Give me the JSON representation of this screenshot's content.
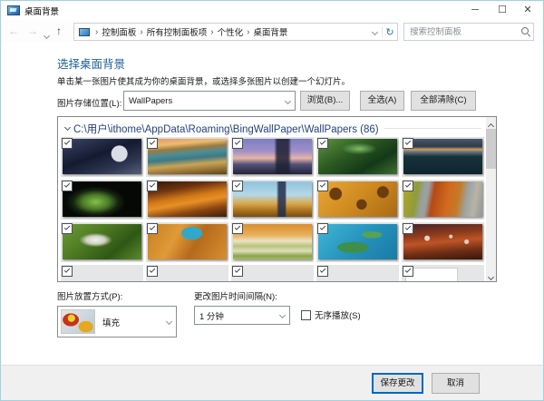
{
  "window": {
    "title": "桌面背景",
    "controls": {
      "minimize": "─",
      "maximize": "☐",
      "close": "✕"
    }
  },
  "colors": {
    "accent": "#0067c0",
    "heading": "#1d6097",
    "group": "#26427c",
    "win-border": "#9fd3e2"
  },
  "navbar": {
    "back_icon": "←",
    "forward_icon": "→",
    "up_icon": "↑",
    "refresh_icon": "↻",
    "address": {
      "crumbs": [
        "控制面板",
        "所有控制面板项",
        "个性化",
        "桌面背景"
      ],
      "separator": "›"
    },
    "search": {
      "placeholder": "搜索控制面板"
    }
  },
  "main": {
    "heading": "选择桌面背景",
    "description": "单击某一张图片使其成为你的桌面背景，或选择多张图片以创建一个幻灯片。",
    "location_row": {
      "label": "图片存储位置(L):",
      "dropdown_value": "WallPapers",
      "browse_button": "浏览(B)...",
      "select_all_button": "全选(A)",
      "clear_all_button": "全部清除(C)"
    },
    "gallery": {
      "group_header": "C:\\用户\\ithome\\AppData\\Roaming\\BingWallPaper\\WallPapers (86)",
      "thumbnails": [
        {
          "name": "night-observatory",
          "checked": true,
          "image": "radial-gradient(circle at 72% 42%, #d8dde6 0, #d8dde6 13%, rgba(216,221,230,0) 14%), linear-gradient(160deg, #3a4668 0%, #141a30 45%, #2e3752 75%, #585f78 100%)"
        },
        {
          "name": "sunset-mountain-lake",
          "checked": true,
          "image": "linear-gradient(175deg, #e0956a 0%, #edbb72 18%, #9a7a3e 30%, #4e8d96 42%, #3c7a85 55%, #caa355 70%, #8a6a30 88%, #5a4418 100%)"
        },
        {
          "name": "twilight-city-trees",
          "checked": true,
          "image": "linear-gradient(90deg, rgba(30,30,50,0) 52%, rgba(30,32,52,0.85) 56%, rgba(30,32,52,0.85) 70%, rgba(30,30,50,0) 74%), linear-gradient(180deg, #7d7fc0 0%, #a18fc9 35%, #e8b4a4 55%, #53537a 72%, #23233a 100%)"
        },
        {
          "name": "green-forest-stream",
          "checked": true,
          "image": "radial-gradient(ellipse 30% 22% at 52% 28%, #7fbf68 0%, rgba(127,191,104,0) 75%), linear-gradient(150deg, #5d9440 0%, #2c5a22 40%, #143818 70%, #3f7032 100%)"
        },
        {
          "name": "dark-sea-dusk",
          "checked": true,
          "image": "linear-gradient(180deg, #49596b 0%, #2e3b4c 22%, #d99a55 30%, #6b7a80 36%, #17323c 50%, #0d252e 100%)"
        },
        {
          "name": "green-parrot-dark",
          "checked": true,
          "image": "radial-gradient(ellipse 38% 45% at 42% 58%, #85c04a 0%, #4a7a28 45%, #152410 75%, #060806 100%)"
        },
        {
          "name": "desert-dunes-dusk",
          "checked": true,
          "image": "linear-gradient(170deg, #2c1608 0%, #6e3310 25%, #d07818 45%, #e89026 58%, #8a4410 78%, #401f08 100%)"
        },
        {
          "name": "golden-statues-sky",
          "checked": true,
          "image": "linear-gradient(90deg, rgba(40,50,70,0) 55%, rgba(35,45,75,0.85) 58%, rgba(35,45,75,0.85) 66%, rgba(40,50,70,0) 68%), linear-gradient(180deg, #8fc3dd 0%, #b5d8e6 38%, #d9a94e 62%, #a8741f 82%, #7a4d12 100%)"
        },
        {
          "name": "honeycomb-desert",
          "checked": true,
          "image": "radial-gradient(circle at 22% 35%, #6b3c0e 0, #6b3c0e 9%, rgba(0,0,0,0) 10%), radial-gradient(circle at 55% 65%, #6b3c0e 0, #6b3c0e 10%, rgba(0,0,0,0) 11%), radial-gradient(circle at 82% 30%, #6b3c0e 0, #6b3c0e 8%, rgba(0,0,0,0) 9%), linear-gradient(135deg, #e8a83a 0%, #cf8a20 50%, #a96a14 100%)"
        },
        {
          "name": "aerial-fields-river",
          "checked": true,
          "image": "linear-gradient(100deg, #b3a62b 0%, #8f9c3a 18%, #9aa0a0 26%, #9aa0a0 31%, #b34a16 38%, #d2691e 55%, #c47b28 68%, #9aa4a4 78%, #b8b4a4 88%, #8c9898 100%)"
        },
        {
          "name": "owl-over-green",
          "checked": true,
          "image": "radial-gradient(ellipse 30% 28% at 42% 45%, #f0f0ea 0%, #cfd2c4 40%, rgba(207,210,196,0) 70%), linear-gradient(140deg, #6f9c38 0%, #47731f 45%, #2f5715 70%, #5d8a2c 100%)"
        },
        {
          "name": "koi-pond-person",
          "checked": true,
          "image": "radial-gradient(ellipse 22% 30% at 56% 26%, #2fa8cc 0, #2fa8cc 60%, rgba(47,168,204,0) 61%), linear-gradient(120deg, #c57d25 0%, #e09a37 35%, #b56a1c 60%, #d88f2e 100%)"
        },
        {
          "name": "terraced-valley",
          "checked": true,
          "image": "linear-gradient(180deg, #d98f35 0%, #e8ae58 30%, #ece2c2 48%, #b9c27c 62%, #dde0ba 76%, #8ba348 90%, #a8bc6a 100%)"
        },
        {
          "name": "turquoise-islands",
          "checked": true,
          "image": "radial-gradient(ellipse 28% 22% at 44% 66%, #3d8f4a 0, #3d8f4a 70%, rgba(61,143,74,0) 71%), radial-gradient(ellipse 18% 14% at 68% 30%, #55a258 0, #55a258 70%, rgba(85,162,88,0) 71%), linear-gradient(135deg, #41b5d6 0%, #2391bb 55%, #1b7aa6 100%)"
        },
        {
          "name": "red-canyon-snow",
          "checked": true,
          "image": "radial-gradient(circle at 30% 40%, rgba(240,238,230,0.85) 0, rgba(240,238,230,0.85) 4%, rgba(240,238,230,0) 5%), radial-gradient(circle at 60% 35%, rgba(240,238,230,0.8) 0, rgba(240,238,230,0.8) 3%, rgba(240,238,230,0) 4%), radial-gradient(circle at 80% 50%, rgba(240,238,230,0.8) 0, rgba(240,238,230,0.8) 3%, rgba(240,238,230,0) 4%), linear-gradient(175deg, #46242c 0%, #8a3a1c 30%, #bf5426 50%, #6e2e14 75%, #3a160c 100%)"
        },
        {
          "name": "hidden-row-wallpaper-1",
          "checked": true
        },
        {
          "name": "hidden-row-wallpaper-2",
          "checked": true
        },
        {
          "name": "hidden-row-wallpaper-3",
          "checked": true
        },
        {
          "name": "hidden-row-wallpaper-4",
          "checked": true
        },
        {
          "name": "hidden-row-wallpaper-placeholder",
          "checked": true,
          "placeholder": true
        }
      ]
    },
    "position_row": {
      "position_label": "图片放置方式(P):",
      "position_value": "填充",
      "preview_image": "radial-gradient(circle at 30% 35%, #f2d22e 0, #f2d22e 13%, rgba(242,210,46,0) 14%), radial-gradient(ellipse 42% 48% at 28% 42%, #c43318 0, #c43318 58%, rgba(196,51,24,0) 60%), radial-gradient(ellipse 38% 42% at 74% 72%, #e8a81c 0, #e8a81c 58%, rgba(232,168,28,0) 60%), linear-gradient(135deg, #e8e3da 0%, #cfd8e0 50%, #b8c8d0 100%)",
      "interval_label": "更改图片时间间隔(N):",
      "interval_value": "1 分钟",
      "shuffle_label": "无序播放(S)",
      "shuffle_checked": false
    }
  },
  "footer": {
    "save_button": "保存更改",
    "cancel_button": "取消"
  }
}
